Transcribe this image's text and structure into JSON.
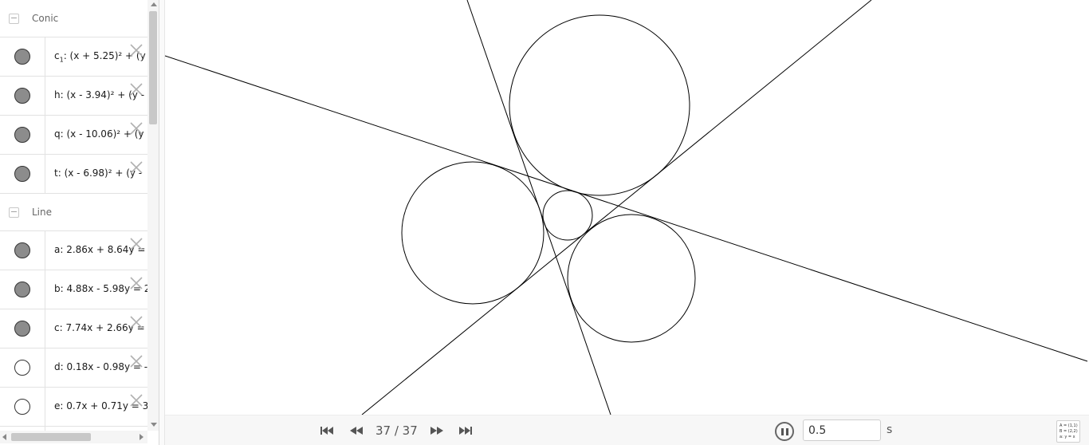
{
  "algebra": {
    "groups": [
      {
        "title": "Conic",
        "toggle": "−",
        "items": [
          {
            "name": "c",
            "sub": "1",
            "rest": ": (x + 5.25)² + (y",
            "visible": true
          },
          {
            "name": "h",
            "sub": "",
            "rest": ": (x - 3.94)² + (y -",
            "visible": true
          },
          {
            "name": "q",
            "sub": "",
            "rest": ": (x - 10.06)² + (y",
            "visible": true
          },
          {
            "name": "t",
            "sub": "",
            "rest": ": (x - 6.98)² + (y -",
            "visible": true
          }
        ]
      },
      {
        "title": "Line",
        "toggle": "−",
        "items": [
          {
            "name": "a",
            "sub": "",
            "rest": ": 2.86x + 8.64y =",
            "visible": true
          },
          {
            "name": "b",
            "sub": "",
            "rest": ": 4.88x - 5.98y = 2",
            "visible": true
          },
          {
            "name": "c",
            "sub": "",
            "rest": ": 7.74x + 2.66y =",
            "visible": true
          },
          {
            "name": "d",
            "sub": "",
            "rest": ": 0.18x - 0.98y = -",
            "visible": false
          },
          {
            "name": "e",
            "sub": "",
            "rest": ": 0.7x + 0.71y = 3",
            "visible": false
          }
        ]
      }
    ],
    "delete_icon": "close-icon"
  },
  "navigation": {
    "current_step": 37,
    "total_steps": 37,
    "step_text": "37 / 37",
    "speed_value": "0.5",
    "speed_unit": "s",
    "algebra_toggle_lines": [
      "A = (1,1)",
      "B = (2,2)",
      "a: y = x"
    ]
  },
  "colors": {
    "marble_on": "#8c8c8c",
    "stroke": "#000000"
  }
}
